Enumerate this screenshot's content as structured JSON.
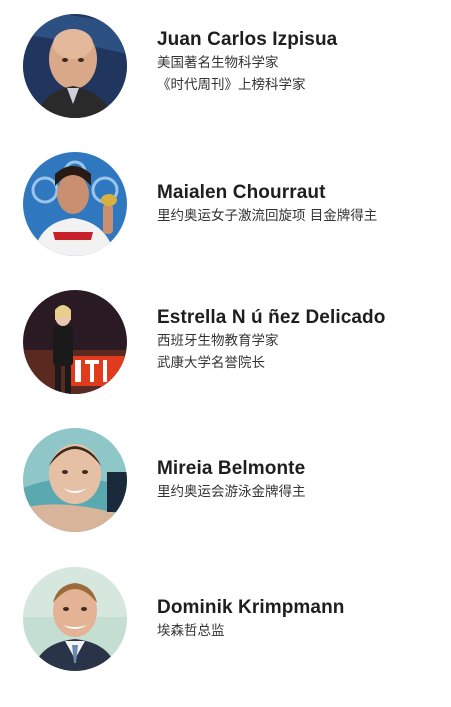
{
  "people": [
    {
      "name": "Juan Carlos Izpisua",
      "lines": [
        "美国著名生物科学家",
        "《时代周刊》上榜科学家"
      ]
    },
    {
      "name": "Maialen Chourraut",
      "lines": [
        "里约奥运女子激流回旋项 目金牌得主"
      ]
    },
    {
      "name": "Estrella N ú ñez Delicado",
      "lines": [
        "西班牙生物教育学家",
        "武康大学名誉院长"
      ]
    },
    {
      "name": "Mireia Belmonte",
      "lines": [
        "里约奥运会游泳金牌得主"
      ]
    },
    {
      "name": "Dominik Krimpmann",
      "lines": [
        "埃森哲总监"
      ]
    }
  ]
}
